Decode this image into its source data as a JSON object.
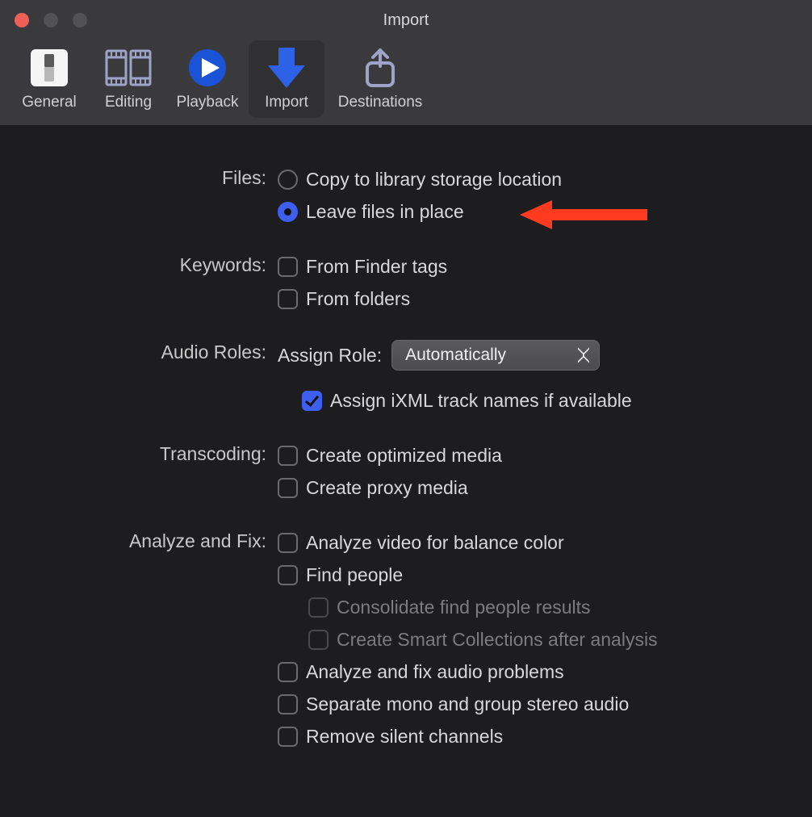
{
  "window": {
    "title": "Import"
  },
  "toolbar": {
    "items": {
      "general": {
        "label": "General"
      },
      "editing": {
        "label": "Editing"
      },
      "playback": {
        "label": "Playback"
      },
      "import": {
        "label": "Import"
      },
      "destinations": {
        "label": "Destinations"
      }
    },
    "active": "import"
  },
  "sections": {
    "files": {
      "label": "Files:",
      "options": {
        "copy": {
          "label": "Copy to library storage location",
          "checked": false
        },
        "leave": {
          "label": "Leave files in place",
          "checked": true
        }
      }
    },
    "keywords": {
      "label": "Keywords:",
      "options": {
        "finder_tags": {
          "label": "From Finder tags",
          "checked": false
        },
        "folders": {
          "label": "From folders",
          "checked": false
        }
      }
    },
    "audio_roles": {
      "label": "Audio Roles:",
      "assign_label": "Assign Role:",
      "select_value": "Automatically",
      "ixml": {
        "label": "Assign iXML track names if available",
        "checked": true
      }
    },
    "transcoding": {
      "label": "Transcoding:",
      "options": {
        "optimized": {
          "label": "Create optimized media",
          "checked": false
        },
        "proxy": {
          "label": "Create proxy media",
          "checked": false
        }
      }
    },
    "analyze": {
      "label": "Analyze and Fix:",
      "options": {
        "balance_color": {
          "label": "Analyze video for balance color",
          "checked": false
        },
        "find_people": {
          "label": "Find people",
          "checked": false
        },
        "consolidate": {
          "label": "Consolidate find people results",
          "checked": false,
          "disabled": true
        },
        "smart_coll": {
          "label": "Create Smart Collections after analysis",
          "checked": false,
          "disabled": true
        },
        "audio_prob": {
          "label": "Analyze and fix audio problems",
          "checked": false
        },
        "separate_mono": {
          "label": "Separate mono and group stereo audio",
          "checked": false
        },
        "remove_silent": {
          "label": "Remove silent channels",
          "checked": false
        }
      }
    }
  },
  "annotation": {
    "color": "#ff3b1f"
  }
}
